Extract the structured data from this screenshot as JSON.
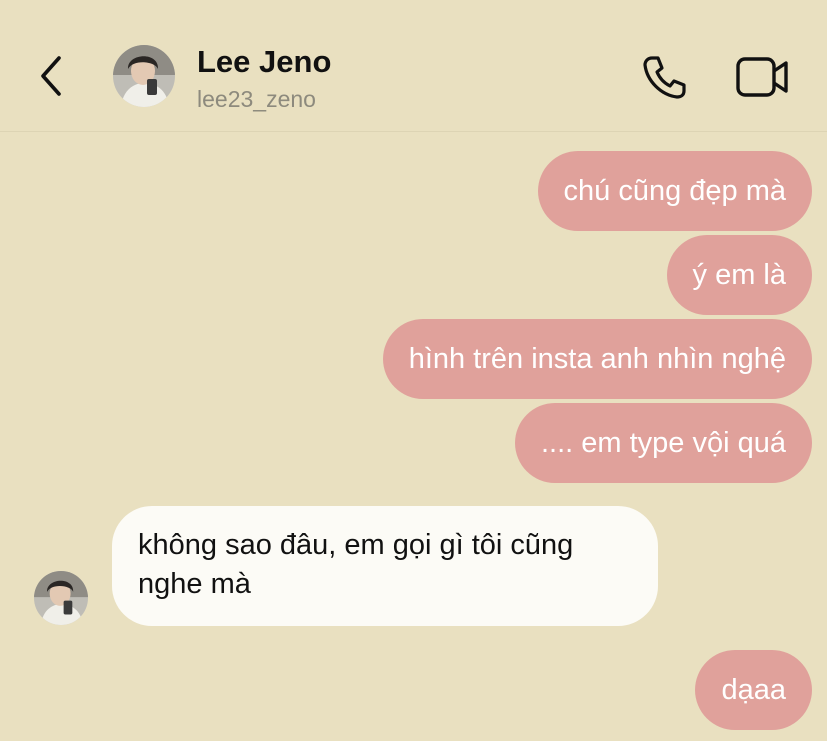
{
  "header": {
    "contact_name": "Lee Jeno",
    "contact_handle": "lee23_zeno",
    "back_icon": "chevron-left-icon",
    "call_icon": "phone-icon",
    "video_icon": "video-camera-icon"
  },
  "messages": [
    {
      "direction": "outgoing",
      "text": "chú cũng đẹp mà"
    },
    {
      "direction": "outgoing",
      "text": "ý em là"
    },
    {
      "direction": "outgoing",
      "text": "hình trên insta anh nhìn nghệ"
    },
    {
      "direction": "outgoing",
      "text": ".... em type vội quá"
    },
    {
      "direction": "incoming",
      "text": "không sao đâu, em gọi gì tôi cũng nghe mà"
    },
    {
      "direction": "outgoing",
      "text": "dạaa"
    }
  ],
  "colors": {
    "background": "#e9e0c0",
    "outgoing_bubble": "#e0a19b",
    "incoming_bubble": "#fcfbf6"
  }
}
